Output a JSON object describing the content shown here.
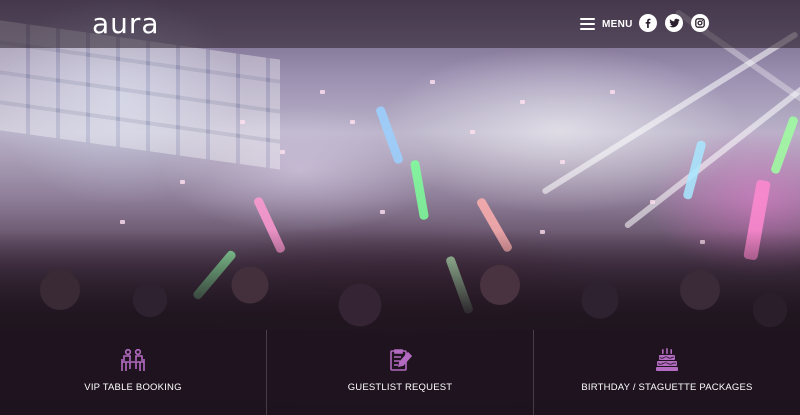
{
  "header": {
    "logo_text": "aura",
    "menu_label": "MENU",
    "social": [
      {
        "name": "facebook-icon"
      },
      {
        "name": "twitter-icon"
      },
      {
        "name": "instagram-icon"
      }
    ]
  },
  "services": [
    {
      "label": "VIP TABLE BOOKING",
      "icon": "vip-table-icon"
    },
    {
      "label": "GUESTLIST REQUEST",
      "icon": "guestlist-icon"
    },
    {
      "label": "BIRTHDAY / STAGUETTE PACKAGES",
      "icon": "birthday-cake-icon"
    }
  ],
  "colors": {
    "icon_accent": "#b26bc0",
    "header_bg": "#28202a",
    "text": "#ffffff"
  }
}
